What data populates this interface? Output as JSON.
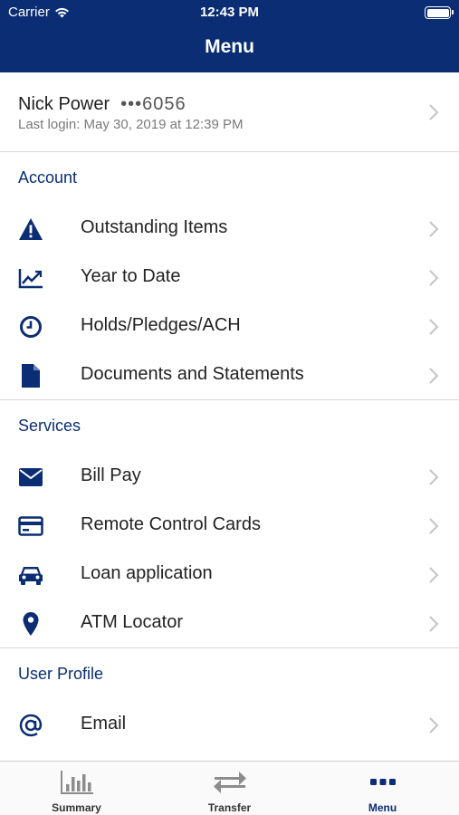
{
  "status_bar": {
    "carrier": "Carrier",
    "time": "12:43 PM"
  },
  "header": {
    "title": "Menu"
  },
  "profile": {
    "name": "Nick Power",
    "account": "•••6056",
    "last_login": "Last login: May 30, 2019 at 12:39 PM"
  },
  "sections": {
    "account": {
      "title": "Account",
      "items": [
        {
          "label": "Outstanding Items",
          "icon": "warning-icon"
        },
        {
          "label": "Year to Date",
          "icon": "chart-line-icon"
        },
        {
          "label": "Holds/Pledges/ACH",
          "icon": "clock-icon"
        },
        {
          "label": "Documents and Statements",
          "icon": "document-icon"
        }
      ]
    },
    "services": {
      "title": "Services",
      "items": [
        {
          "label": "Bill Pay",
          "icon": "envelope-icon"
        },
        {
          "label": "Remote Control Cards",
          "icon": "credit-card-icon"
        },
        {
          "label": "Loan application",
          "icon": "car-icon"
        },
        {
          "label": "ATM Locator",
          "icon": "map-pin-icon"
        }
      ]
    },
    "user_profile": {
      "title": "User Profile",
      "items": [
        {
          "label": "Email",
          "icon": "at-sign-icon"
        }
      ]
    }
  },
  "tabbar": {
    "tabs": [
      {
        "label": "Summary",
        "icon": "bar-chart-icon",
        "active": false
      },
      {
        "label": "Transfer",
        "icon": "transfer-arrows-icon",
        "active": false
      },
      {
        "label": "Menu",
        "icon": "ellipsis-icon",
        "active": true
      }
    ]
  },
  "colors": {
    "brand": "#0a2d73",
    "text": "#222222",
    "muted": "#7a7a7a",
    "divider": "#d8d8d8"
  }
}
